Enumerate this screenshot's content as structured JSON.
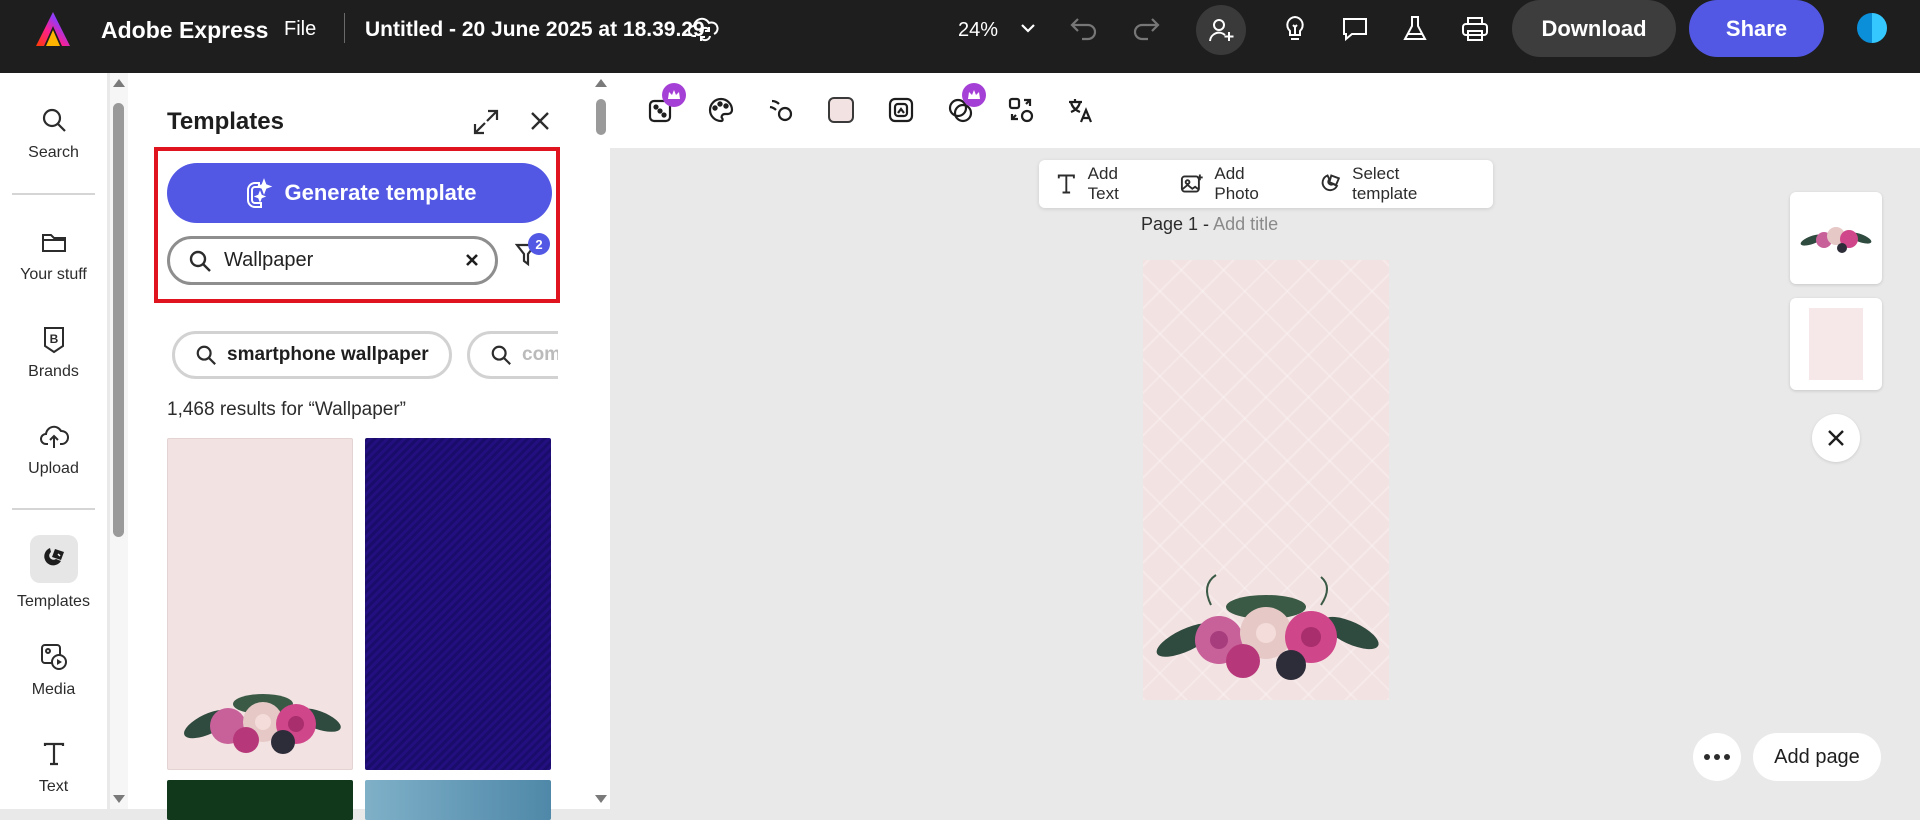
{
  "topbar": {
    "app_name": "Adobe Express",
    "file_menu": "File",
    "doc_title": "Untitled - 20 June 2025 at 18.39.29",
    "zoom": "24%",
    "download_label": "Download",
    "share_label": "Share",
    "icons": [
      "adobe-express-logo",
      "cloud-sync-icon",
      "chevron-down-icon",
      "undo-icon",
      "redo-icon",
      "invite-user-icon",
      "lightbulb-icon",
      "comment-icon",
      "flask-icon",
      "print-icon"
    ]
  },
  "rail": {
    "items": [
      {
        "label": "Search",
        "icon": "search-icon"
      },
      {
        "label": "Your stuff",
        "icon": "folder-icon"
      },
      {
        "label": "Brands",
        "icon": "brand-icon"
      },
      {
        "label": "Upload",
        "icon": "upload-cloud-icon"
      },
      {
        "label": "Templates",
        "icon": "templates-icon",
        "active": true
      },
      {
        "label": "Media",
        "icon": "media-icon"
      },
      {
        "label": "Text",
        "icon": "text-icon"
      }
    ]
  },
  "panel": {
    "title": "Templates",
    "generate_label": "Generate template",
    "search_value": "Wallpaper",
    "filter_count": "2",
    "chips": [
      "smartphone wallpaper",
      "com"
    ],
    "results_text": "1,468 results for “Wallpaper”"
  },
  "canvas": {
    "quick_actions": [
      "Add Text",
      "Add Photo",
      "Select template"
    ],
    "page_label": "Page 1 - ",
    "page_title_placeholder": "Add title",
    "add_page_label": "Add page"
  },
  "colors": {
    "topbar_bg": "#1e1e1e",
    "accent": "#5258e4",
    "highlight": "#e0141e",
    "premium_crown": "#a540d6",
    "page_pink": "#f3e2e2"
  }
}
